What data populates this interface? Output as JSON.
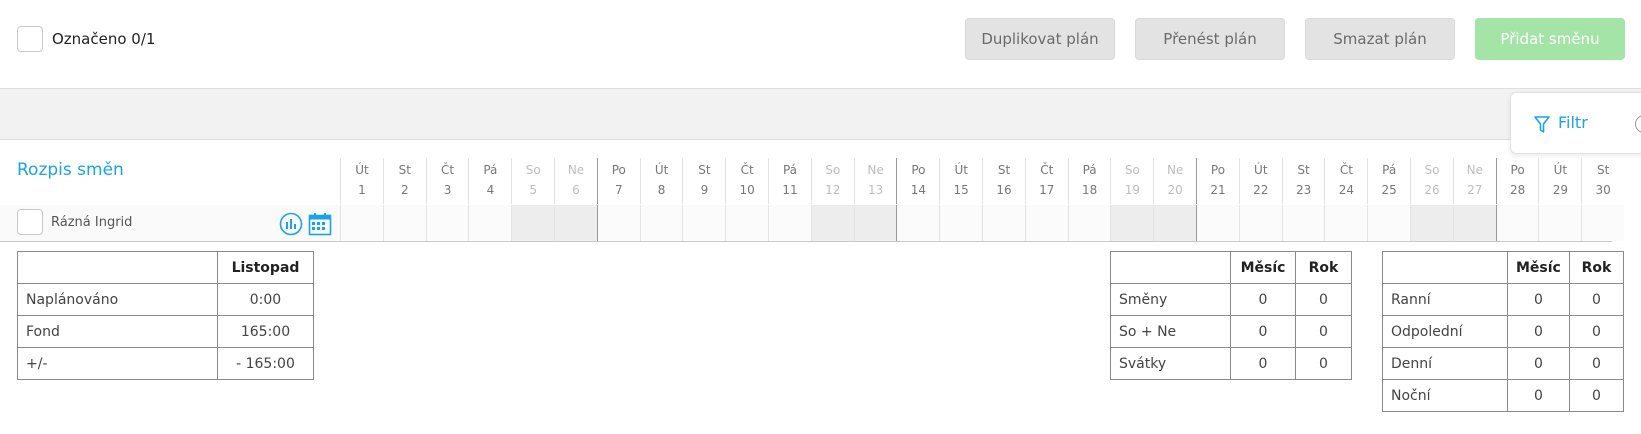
{
  "top": {
    "marked_label": "Označeno 0/1",
    "buttons": {
      "duplicate": "Duplikovat plán",
      "transfer": "Přenést plán",
      "delete": "Smazat plán",
      "add_shift": "Přidat směnu"
    },
    "accent_color": "#1aa3e8",
    "primary_color": "#a5e4a7"
  },
  "filter": {
    "label": "Filtr",
    "icon": "filter-icon"
  },
  "schedule": {
    "title": "Rozpis směn",
    "days": [
      {
        "abbr": "Út",
        "num": "1",
        "weekend": false
      },
      {
        "abbr": "St",
        "num": "2",
        "weekend": false
      },
      {
        "abbr": "Čt",
        "num": "3",
        "weekend": false
      },
      {
        "abbr": "Pá",
        "num": "4",
        "weekend": false
      },
      {
        "abbr": "So",
        "num": "5",
        "weekend": true
      },
      {
        "abbr": "Ne",
        "num": "6",
        "weekend": true
      },
      {
        "abbr": "Po",
        "num": "7",
        "weekend": false
      },
      {
        "abbr": "Út",
        "num": "8",
        "weekend": false
      },
      {
        "abbr": "St",
        "num": "9",
        "weekend": false
      },
      {
        "abbr": "Čt",
        "num": "10",
        "weekend": false
      },
      {
        "abbr": "Pá",
        "num": "11",
        "weekend": false
      },
      {
        "abbr": "So",
        "num": "12",
        "weekend": true
      },
      {
        "abbr": "Ne",
        "num": "13",
        "weekend": true
      },
      {
        "abbr": "Po",
        "num": "14",
        "weekend": false
      },
      {
        "abbr": "Út",
        "num": "15",
        "weekend": false
      },
      {
        "abbr": "St",
        "num": "16",
        "weekend": false
      },
      {
        "abbr": "Čt",
        "num": "17",
        "weekend": false
      },
      {
        "abbr": "Pá",
        "num": "18",
        "weekend": false
      },
      {
        "abbr": "So",
        "num": "19",
        "weekend": true
      },
      {
        "abbr": "Ne",
        "num": "20",
        "weekend": true
      },
      {
        "abbr": "Po",
        "num": "21",
        "weekend": false
      },
      {
        "abbr": "Út",
        "num": "22",
        "weekend": false
      },
      {
        "abbr": "St",
        "num": "23",
        "weekend": false
      },
      {
        "abbr": "Čt",
        "num": "24",
        "weekend": false
      },
      {
        "abbr": "Pá",
        "num": "25",
        "weekend": false
      },
      {
        "abbr": "So",
        "num": "26",
        "weekend": true
      },
      {
        "abbr": "Ne",
        "num": "27",
        "weekend": true
      },
      {
        "abbr": "Po",
        "num": "28",
        "weekend": false
      },
      {
        "abbr": "Út",
        "num": "29",
        "weekend": false
      },
      {
        "abbr": "St",
        "num": "30",
        "weekend": false
      }
    ],
    "employees": [
      {
        "name": "Rázná Ingrid",
        "icons": [
          "chart-icon",
          "calendar-icon"
        ]
      }
    ]
  },
  "stats_month": {
    "header": "Listopad",
    "rows": [
      {
        "label": "Naplánováno",
        "value": "0:00"
      },
      {
        "label": "Fond",
        "value": "165:00"
      },
      {
        "label": "+/-",
        "value": "- 165:00"
      }
    ]
  },
  "stats_shifts": {
    "headers": [
      "Měsíc",
      "Rok"
    ],
    "rows": [
      {
        "label": "Směny",
        "month": "0",
        "year": "0"
      },
      {
        "label": "So + Ne",
        "month": "0",
        "year": "0"
      },
      {
        "label": "Svátky",
        "month": "0",
        "year": "0"
      }
    ]
  },
  "stats_types": {
    "headers": [
      "Měsíc",
      "Rok"
    ],
    "rows": [
      {
        "label": "Ranní",
        "month": "0",
        "year": "0"
      },
      {
        "label": "Odpolední",
        "month": "0",
        "year": "0"
      },
      {
        "label": "Denní",
        "month": "0",
        "year": "0"
      },
      {
        "label": "Noční",
        "month": "0",
        "year": "0"
      }
    ]
  }
}
